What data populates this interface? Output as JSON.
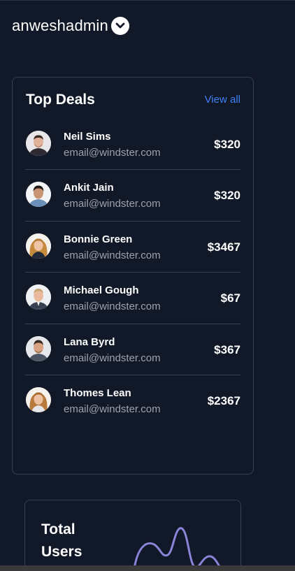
{
  "header": {
    "username": "anweshadmin"
  },
  "top_deals": {
    "title": "Top Deals",
    "view_all_label": "View all",
    "deals": [
      {
        "name": "Neil Sims",
        "email": "email@windster.com",
        "amount": "$320"
      },
      {
        "name": "Ankit Jain",
        "email": "email@windster.com",
        "amount": "$320"
      },
      {
        "name": "Bonnie Green",
        "email": "email@windster.com",
        "amount": "$3467"
      },
      {
        "name": "Michael Gough",
        "email": "email@windster.com",
        "amount": "$67"
      },
      {
        "name": "Lana Byrd",
        "email": "email@windster.com",
        "amount": "$367"
      },
      {
        "name": "Thomes Lean",
        "email": "email@windster.com",
        "amount": "$2367"
      }
    ]
  },
  "total_users": {
    "title": "Total Users",
    "line_color": "#8884d8"
  },
  "colors": {
    "background": "#111827",
    "border": "#374151",
    "accent": "#3b82f6",
    "muted_text": "#9ca3af"
  }
}
